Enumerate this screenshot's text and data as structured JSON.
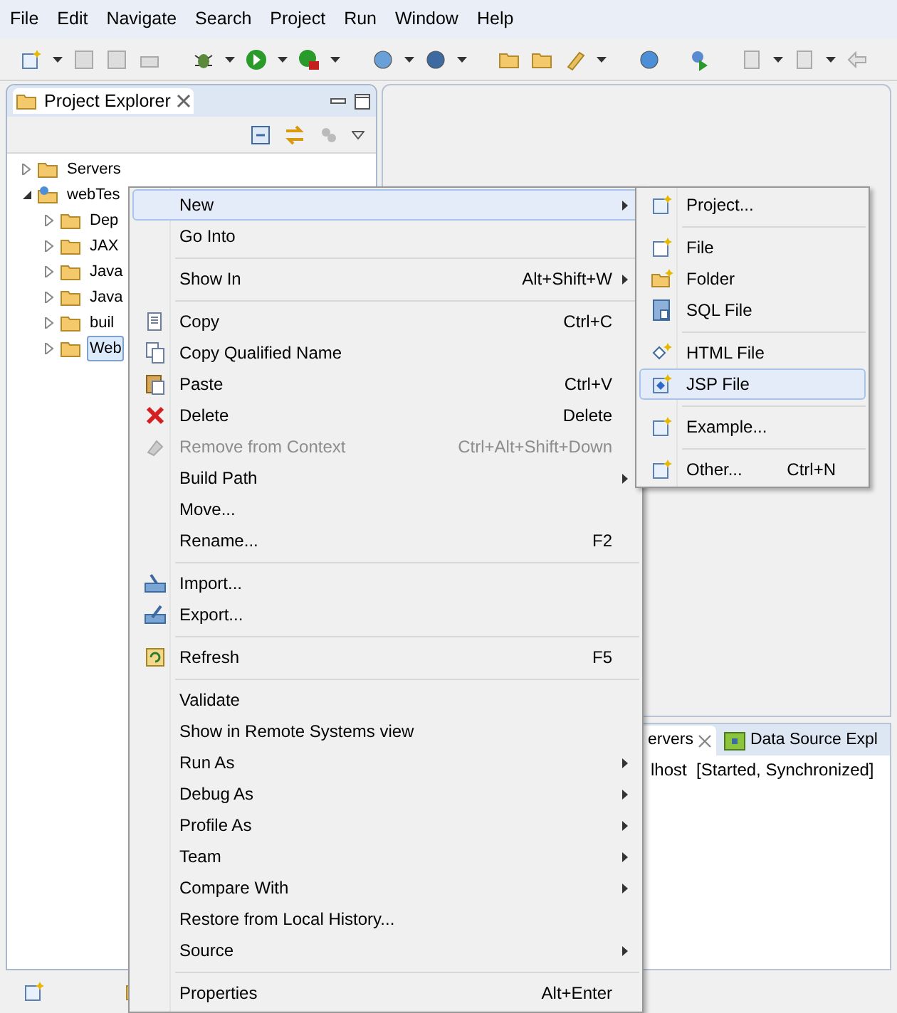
{
  "menubar": [
    "File",
    "Edit",
    "Navigate",
    "Search",
    "Project",
    "Run",
    "Window",
    "Help"
  ],
  "project_explorer": {
    "title": "Project Explorer",
    "tree": [
      {
        "label": "Servers",
        "expanded": false,
        "selected": false
      },
      {
        "label": "webTes",
        "expanded": true,
        "selected": false,
        "children": [
          {
            "label": "Dep",
            "expanded": false,
            "selected": false
          },
          {
            "label": "JAX",
            "expanded": false,
            "selected": false
          },
          {
            "label": "Java",
            "expanded": false,
            "selected": false
          },
          {
            "label": "Java",
            "expanded": false,
            "selected": false
          },
          {
            "label": "buil",
            "expanded": false,
            "selected": false
          },
          {
            "label": "Web",
            "expanded": false,
            "selected": true
          }
        ]
      }
    ]
  },
  "bottom_panel": {
    "tabs": [
      {
        "label": "ervers",
        "selected": true
      },
      {
        "label": "Data Source Expl",
        "selected": false
      }
    ],
    "rows": [
      "lhost  [Started, Synchronized]"
    ]
  },
  "context_menu": {
    "items": [
      {
        "kind": "item",
        "label": "New",
        "submenu": true,
        "disabled": false,
        "selected": true
      },
      {
        "kind": "item",
        "label": "Go Into",
        "submenu": false,
        "disabled": false,
        "selected": false
      },
      {
        "kind": "separator"
      },
      {
        "kind": "item",
        "label": "Show In",
        "shortcut": "Alt+Shift+W",
        "submenu": true,
        "disabled": false,
        "selected": false
      },
      {
        "kind": "separator"
      },
      {
        "kind": "item",
        "label": "Copy",
        "shortcut": "Ctrl+C",
        "submenu": false,
        "disabled": false,
        "selected": false
      },
      {
        "kind": "item",
        "label": "Copy Qualified Name",
        "submenu": false,
        "disabled": false,
        "selected": false
      },
      {
        "kind": "item",
        "label": "Paste",
        "shortcut": "Ctrl+V",
        "submenu": false,
        "disabled": false,
        "selected": false
      },
      {
        "kind": "item",
        "label": "Delete",
        "shortcut": "Delete",
        "submenu": false,
        "disabled": false,
        "selected": false
      },
      {
        "kind": "item",
        "label": "Remove from Context",
        "shortcut": "Ctrl+Alt+Shift+Down",
        "submenu": false,
        "disabled": true,
        "selected": false
      },
      {
        "kind": "item",
        "label": "Build Path",
        "submenu": true,
        "disabled": false,
        "selected": false
      },
      {
        "kind": "item",
        "label": "Move...",
        "submenu": false,
        "disabled": false,
        "selected": false
      },
      {
        "kind": "item",
        "label": "Rename...",
        "shortcut": "F2",
        "submenu": false,
        "disabled": false,
        "selected": false
      },
      {
        "kind": "separator"
      },
      {
        "kind": "item",
        "label": "Import...",
        "submenu": false,
        "disabled": false,
        "selected": false
      },
      {
        "kind": "item",
        "label": "Export...",
        "submenu": false,
        "disabled": false,
        "selected": false
      },
      {
        "kind": "separator"
      },
      {
        "kind": "item",
        "label": "Refresh",
        "shortcut": "F5",
        "submenu": false,
        "disabled": false,
        "selected": false
      },
      {
        "kind": "separator"
      },
      {
        "kind": "item",
        "label": "Validate",
        "submenu": false,
        "disabled": false,
        "selected": false
      },
      {
        "kind": "item",
        "label": "Show in Remote Systems view",
        "submenu": false,
        "disabled": false,
        "selected": false
      },
      {
        "kind": "item",
        "label": "Run As",
        "submenu": true,
        "disabled": false,
        "selected": false
      },
      {
        "kind": "item",
        "label": "Debug As",
        "submenu": true,
        "disabled": false,
        "selected": false
      },
      {
        "kind": "item",
        "label": "Profile As",
        "submenu": true,
        "disabled": false,
        "selected": false
      },
      {
        "kind": "item",
        "label": "Team",
        "submenu": true,
        "disabled": false,
        "selected": false
      },
      {
        "kind": "item",
        "label": "Compare With",
        "submenu": true,
        "disabled": false,
        "selected": false
      },
      {
        "kind": "item",
        "label": "Restore from Local History...",
        "submenu": false,
        "disabled": false,
        "selected": false
      },
      {
        "kind": "item",
        "label": "Source",
        "submenu": true,
        "disabled": false,
        "selected": false
      },
      {
        "kind": "separator"
      },
      {
        "kind": "item",
        "label": "Properties",
        "shortcut": "Alt+Enter",
        "submenu": false,
        "disabled": false,
        "selected": false
      }
    ]
  },
  "new_submenu": {
    "items": [
      {
        "kind": "item",
        "label": "Project...",
        "selected": false
      },
      {
        "kind": "separator"
      },
      {
        "kind": "item",
        "label": "File",
        "selected": false
      },
      {
        "kind": "item",
        "label": "Folder",
        "selected": false
      },
      {
        "kind": "item",
        "label": "SQL File",
        "selected": false
      },
      {
        "kind": "separator"
      },
      {
        "kind": "item",
        "label": "HTML File",
        "selected": false
      },
      {
        "kind": "item",
        "label": "JSP File",
        "selected": true
      },
      {
        "kind": "separator"
      },
      {
        "kind": "item",
        "label": "Example...",
        "selected": false
      },
      {
        "kind": "separator"
      },
      {
        "kind": "item",
        "label": "Other...",
        "shortcut": "Ctrl+N",
        "selected": false
      }
    ]
  }
}
